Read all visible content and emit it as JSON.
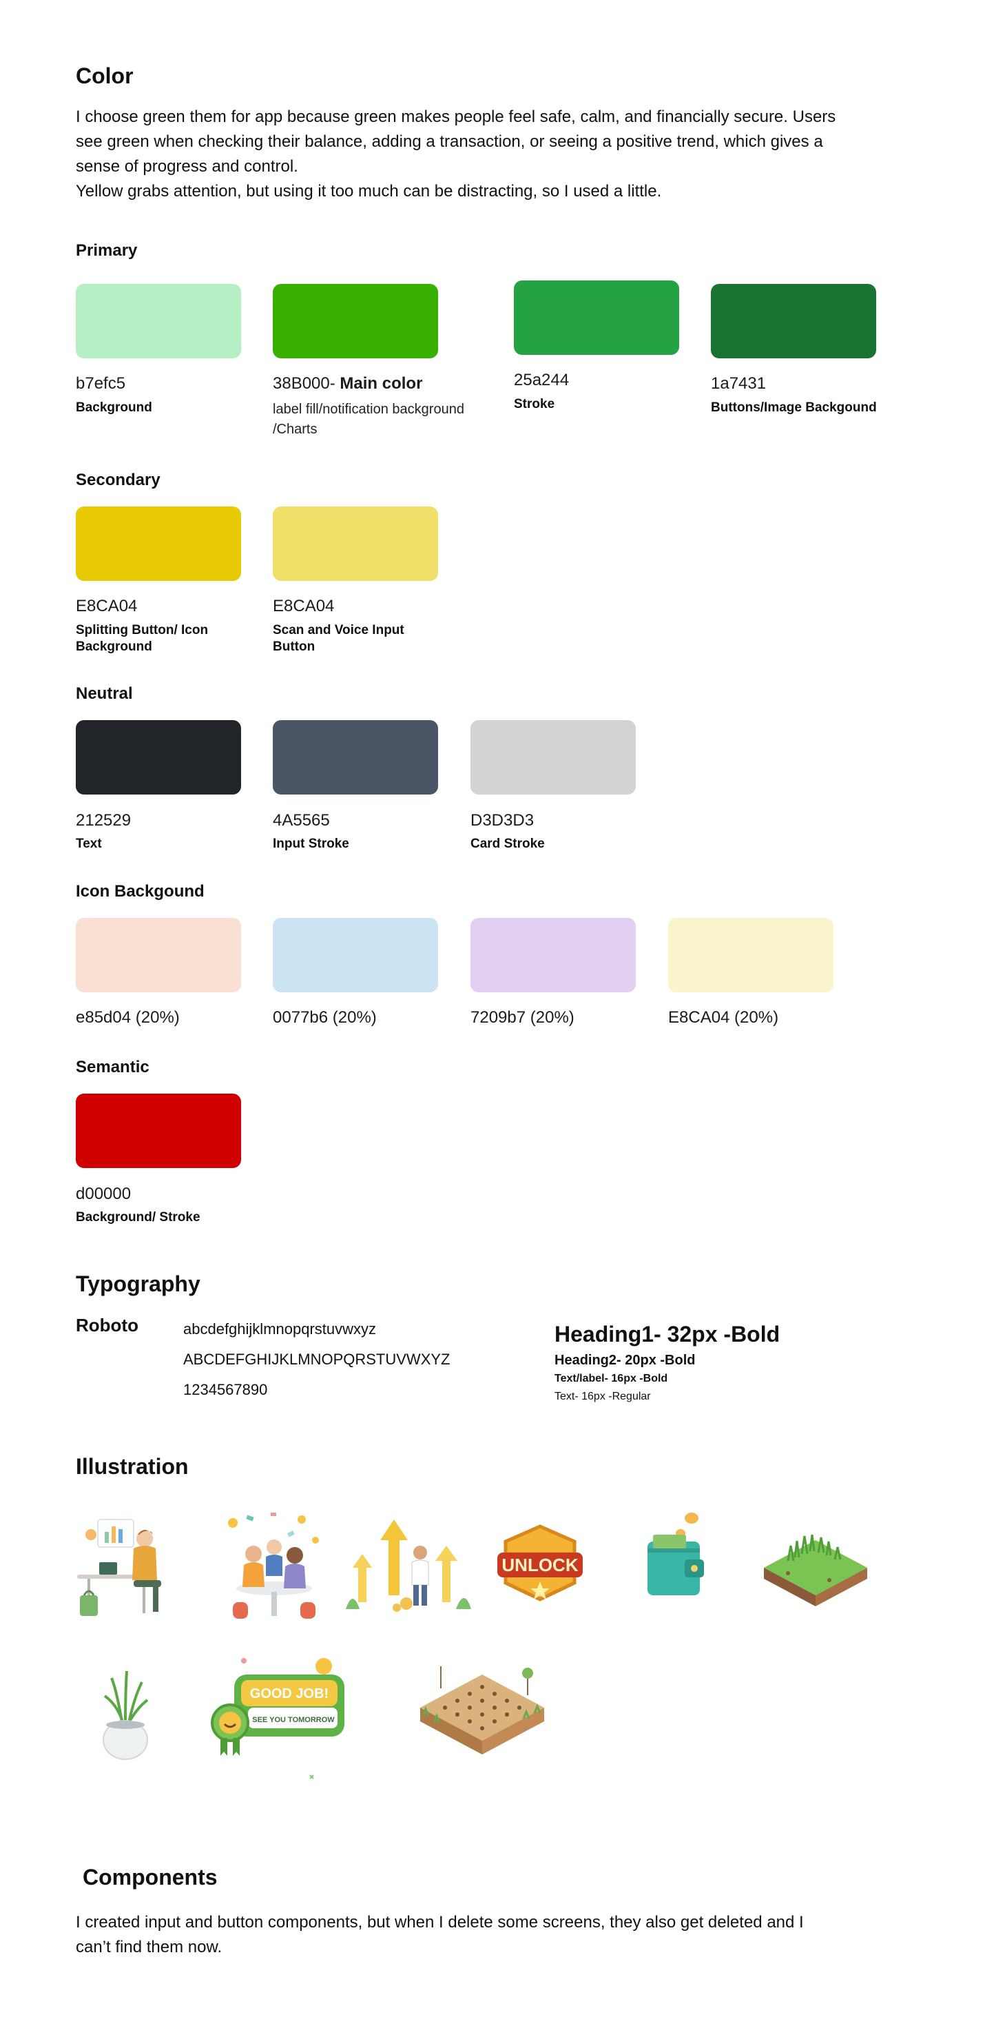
{
  "color_section": {
    "title": "Color",
    "intro_lines": [
      "I choose green them for app because green makes people feel safe, calm, and financially secure. Users",
      "see green when checking their balance, adding a transaction, or seeing a positive trend, which gives a",
      "sense of progress and control.",
      "Yellow grabs attention, but using it too much can be distracting, so I used a little."
    ]
  },
  "primary": {
    "title": "Primary",
    "swatches": [
      {
        "hex": "#b7efc5",
        "code": "b7efc5",
        "label": "Background"
      },
      {
        "hex": "#38B000",
        "code": "38B000-",
        "emphasis": "Main color",
        "desc1": "label fill/notification background",
        "desc2": "/Charts"
      },
      {
        "hex": "#25a244",
        "code": "25a244",
        "label": "Stroke"
      },
      {
        "hex": "#1a7431",
        "code": "1a7431",
        "label": "Buttons/Image Backgound"
      }
    ]
  },
  "secondary": {
    "title": "Secondary",
    "swatches": [
      {
        "hex": "#E8CA04",
        "code": "E8CA04",
        "label1": "Splitting Button/ Icon",
        "label2": "Background"
      },
      {
        "hex": "#F0DF68",
        "code": "E8CA04",
        "label1": "Scan and Voice Input",
        "label2": "Button"
      }
    ]
  },
  "neutral": {
    "title": "Neutral",
    "swatches": [
      {
        "hex": "#212529",
        "code": "212529",
        "label": "Text"
      },
      {
        "hex": "#4A5565",
        "code": "4A5565",
        "label": "Input Stroke"
      },
      {
        "hex": "#D3D3D3",
        "code": "D3D3D3",
        "label": "Card Stroke"
      }
    ]
  },
  "icon_bg": {
    "title": "Icon Backgound",
    "swatches": [
      {
        "hex": "#FAE0D3",
        "code": "e85d04 (20%)"
      },
      {
        "hex": "#CCE4F1",
        "code": "0077b6 (20%)"
      },
      {
        "hex": "#E3CFF1",
        "code": "7209b7 (20%)"
      },
      {
        "hex": "#FAF4CD",
        "code": "E8CA04 (20%)"
      }
    ]
  },
  "semantic": {
    "title": "Semantic",
    "swatches": [
      {
        "hex": "#d00000",
        "code": "d00000",
        "label": "Background/ Stroke"
      }
    ]
  },
  "typography": {
    "title": "Typography",
    "font_name": "Roboto",
    "lowercase": "abcdefghijklmnopqrstuvwxyz",
    "uppercase": "ABCDEFGHIJKLMNOPQRSTUVWXYZ",
    "digits": "1234567890",
    "heading1": "Heading1- 32px -Bold",
    "heading2": "Heading2- 20px -Bold",
    "textlabel": "Text/label- 16px -Bold",
    "text": "Text- 16px -Regular"
  },
  "illustration": {
    "title": "Illustration",
    "badge_text": "UNLOCK",
    "goodjob_text": "GOOD JOB!",
    "tomorrow_text": "SEE YOU TOMORROW",
    "items": [
      "person-at-desk-illustration",
      "team-celebration-illustration",
      "growth-arrows-illustration",
      "unlock-badge-illustration",
      "wallet-coins-illustration",
      "grass-block-illustration",
      "plant-pot-illustration",
      "good-job-badge-illustration",
      "garden-plot-illustration"
    ]
  },
  "components": {
    "title": "Components",
    "lines": [
      "I created input and button components, but when I delete some screens, they also get deleted and I",
      "can’t find them now."
    ]
  }
}
